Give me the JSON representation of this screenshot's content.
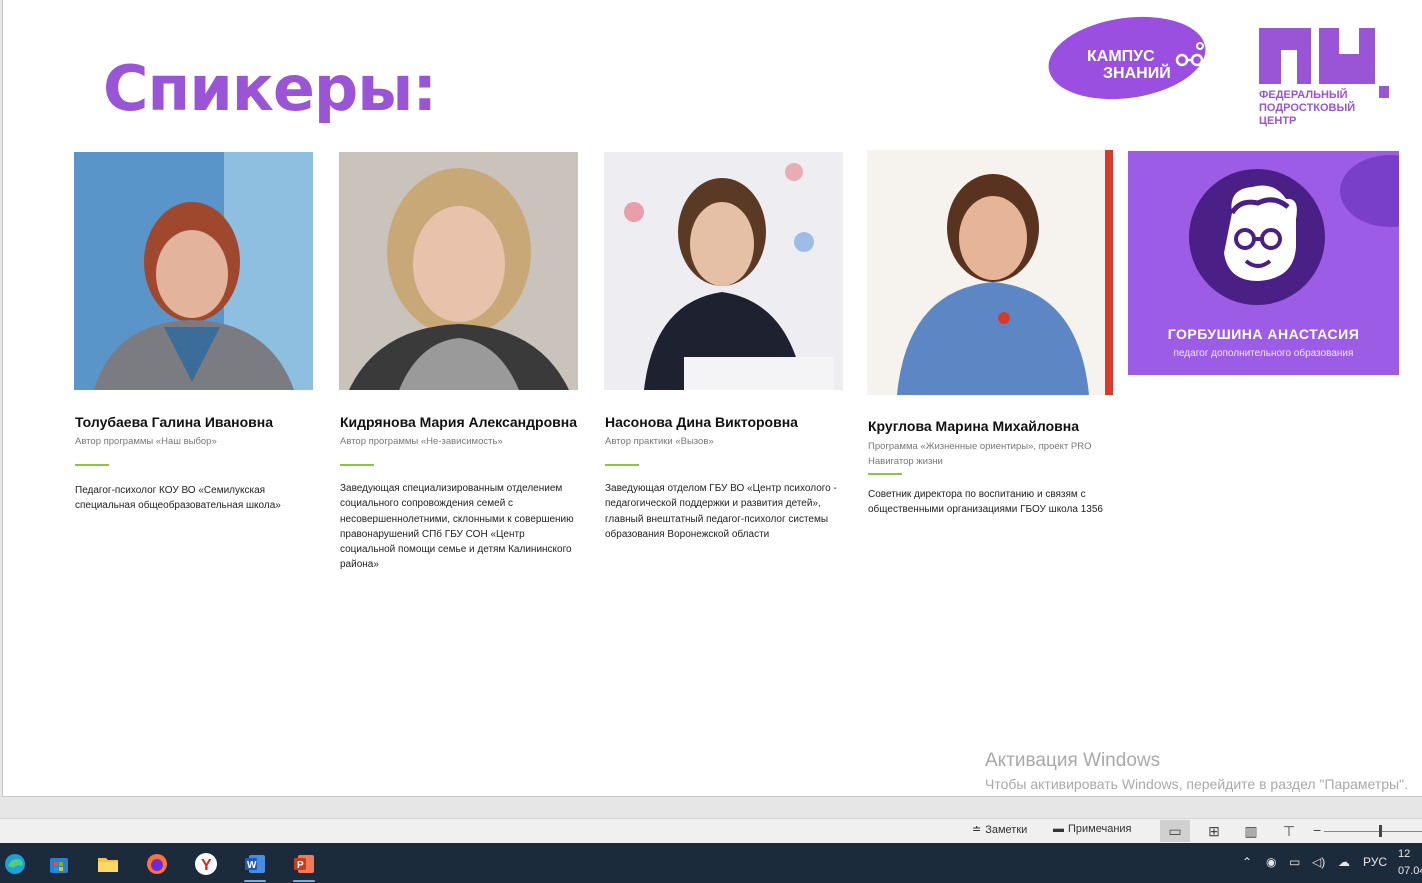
{
  "slide": {
    "title": "Спикеры:",
    "logos": {
      "kampus_line1": "КАМПУС",
      "kampus_line2": "ЗНАНИЙ",
      "fpc_line1": "ФЕДЕРАЛЬНЫЙ",
      "fpc_line2": "ПОДРОСТКОВЫЙ",
      "fpc_line3": "ЦЕНТР"
    },
    "speakers": [
      {
        "name": "Толубаева Галина Ивановна",
        "role": "Автор программы «Наш выбор»",
        "description": "Педагог-психолог КОУ ВО «Семилукская специальная общеобразовательная школа»"
      },
      {
        "name": "Кидрянова Мария Александровна",
        "role": "Автор программы «Не-зависимость»",
        "description": "Заведующая специализированным отделением социального сопровождения семей с несовершеннолетними, склонными к совершению правонарушений СПб ГБУ СОН «Центр социальной помощи семье и детям Калининского района»"
      },
      {
        "name": "Насонова Дина Викторовна",
        "role": "Автор практики «Вызов»",
        "description": "Заведующая отделом ГБУ ВО «Центр психолого - педагогической поддержки и развития детей», главный внештатный педагог-психолог системы образования Воронежской области"
      },
      {
        "name": "Круглова Марина Михайловна",
        "role": "Программа «Жизненные ориентиры», проект PRO Навигатор жизни",
        "description": "Советник директора по воспитанию и связям с общественными организациями ГБОУ школа 1356"
      }
    ],
    "card5": {
      "name": "ГОРБУШИНА АНАСТАСИЯ",
      "subtitle": "педагог дополнительного образования"
    },
    "watermark": {
      "line1": "Активация Windows",
      "line2": "Чтобы активировать Windows, перейдите в раздел \"Параметры\"."
    }
  },
  "statusbar": {
    "notes_label": "Заметки",
    "comments_label": "Примечания"
  },
  "taskbar": {
    "apps": [
      "edge-icon",
      "windows-store-icon",
      "file-explorer-icon",
      "firefox-icon",
      "yandex-browser-icon",
      "word-icon",
      "powerpoint-icon"
    ],
    "language": "РУС",
    "time": "12",
    "date": "07.04"
  },
  "colors": {
    "accent_purple": "#9a55d6",
    "green_rule": "#8bc34a",
    "taskbar_bg": "#1c2b3c"
  }
}
